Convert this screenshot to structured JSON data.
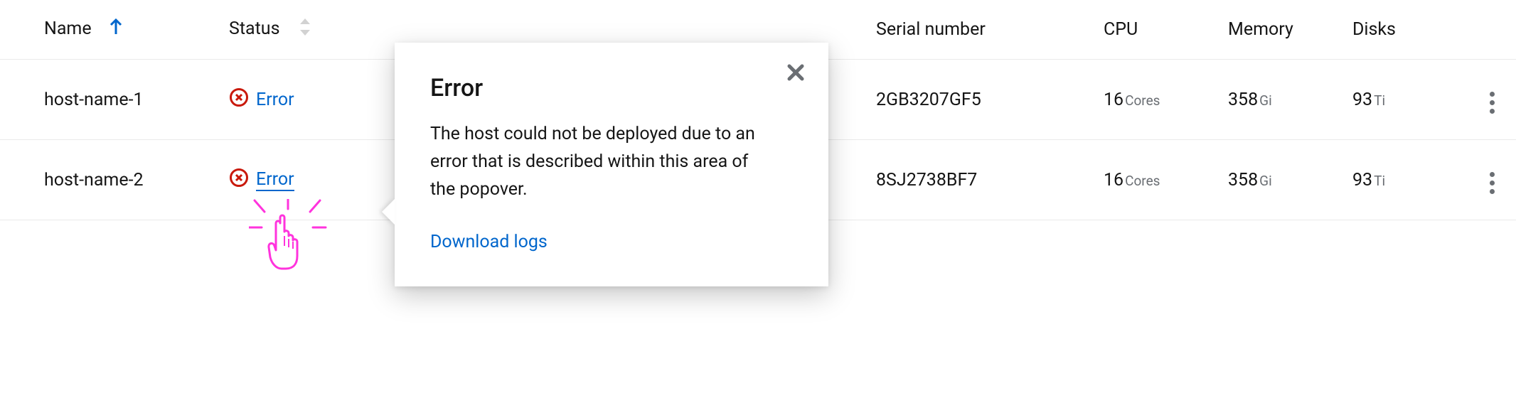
{
  "table": {
    "columns": {
      "name": "Name",
      "status": "Status",
      "serial": "Serial number",
      "cpu": "CPU",
      "memory": "Memory",
      "disks": "Disks"
    },
    "rows": [
      {
        "name": "host-name-1",
        "status": "Error",
        "serial": "2GB3207GF5",
        "cpu_value": "16",
        "cpu_unit": "Cores",
        "memory_value": "358",
        "memory_unit": "Gi",
        "disks_value": "93",
        "disks_unit": "Ti"
      },
      {
        "name": "host-name-2",
        "status": "Error",
        "serial": "8SJ2738BF7",
        "cpu_value": "16",
        "cpu_unit": "Cores",
        "memory_value": "358",
        "memory_unit": "Gi",
        "disks_value": "93",
        "disks_unit": "Ti"
      }
    ]
  },
  "popover": {
    "title": "Error",
    "body": "The host could not be deployed due to an error that is described within this area of the popover.",
    "link": "Download logs"
  }
}
